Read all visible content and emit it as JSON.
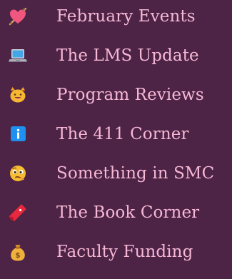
{
  "menu": {
    "items": [
      {
        "label": "February Events",
        "icon": "heart-with-arrow-icon"
      },
      {
        "label": "The LMS Update",
        "icon": "laptop-icon"
      },
      {
        "label": "Program Reviews",
        "icon": "grinning-cat-icon"
      },
      {
        "label": "The 411 Corner",
        "icon": "information-icon"
      },
      {
        "label": "Something in SMC",
        "icon": "face-with-raised-eyebrow-icon"
      },
      {
        "label": "The Book Corner",
        "icon": "bookmark-icon"
      },
      {
        "label": "Faculty Funding",
        "icon": "money-bag-icon"
      }
    ]
  },
  "colors": {
    "background": "#4d2346",
    "text": "#f6b8d5"
  }
}
